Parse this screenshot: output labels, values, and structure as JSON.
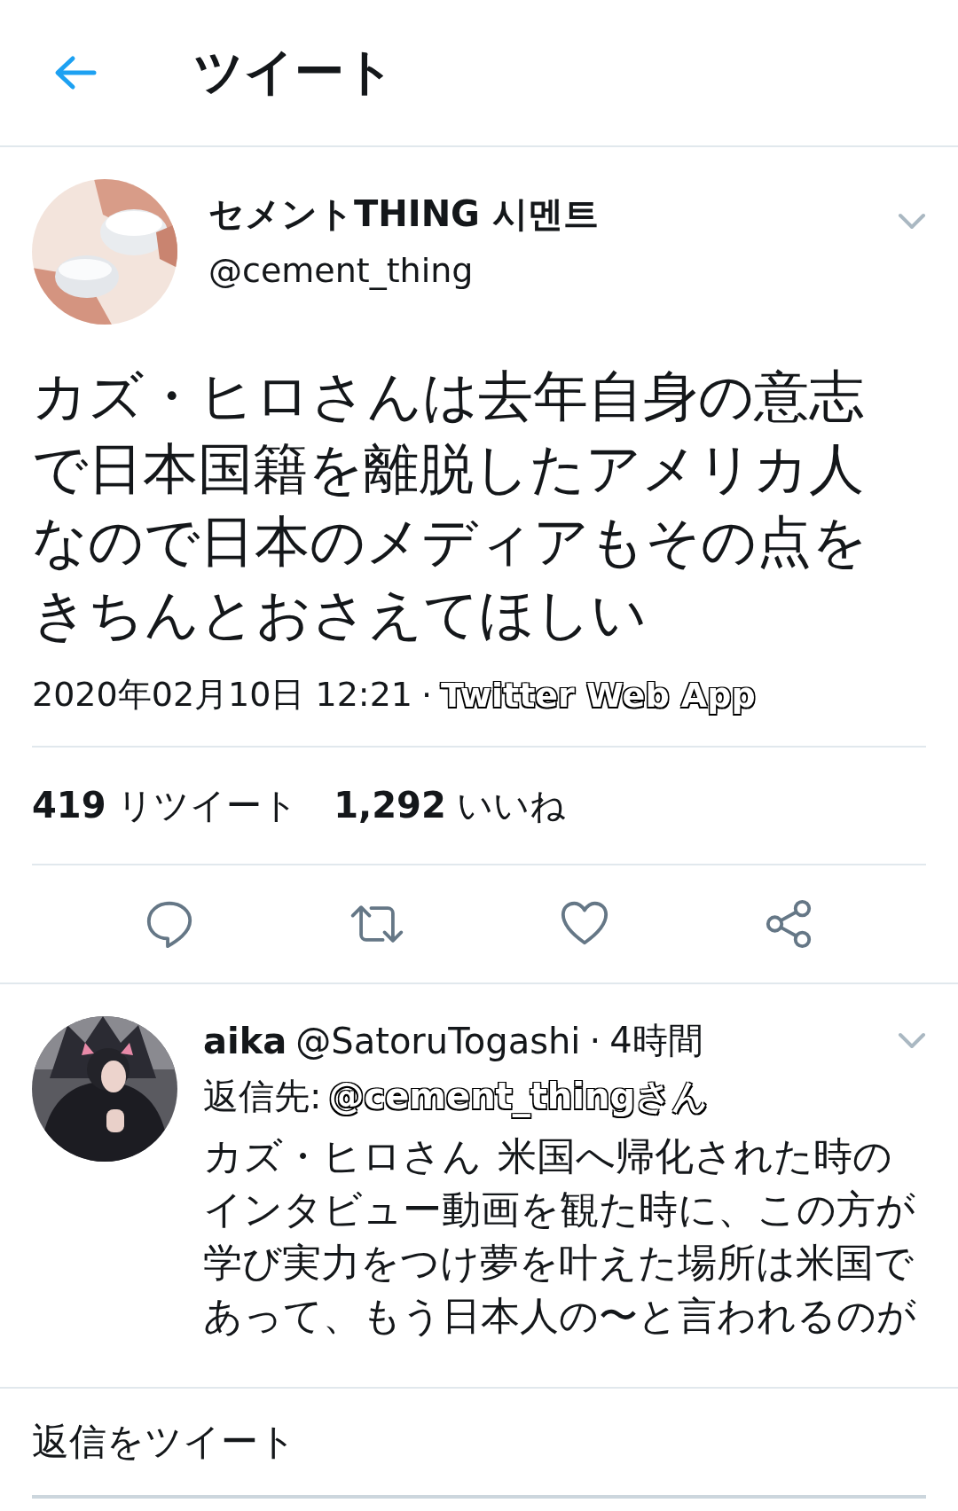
{
  "header": {
    "title": "ツイート"
  },
  "tweet": {
    "display_name": "セメントTHING 시멘트",
    "handle": "@cement_thing",
    "text": "カズ・ヒロさんは去年自身の意志で日本国籍を離脱したアメリカ人なので日本のメディアもその点をきちんとおさえてほしい",
    "timestamp": "2020年02月10日 12:21",
    "separator": "·",
    "source": "Twitter Web App",
    "stats": [
      {
        "count": "419",
        "label": "リツイート"
      },
      {
        "count": "1,292",
        "label": "いいね"
      }
    ]
  },
  "reply": {
    "display_name": "aika",
    "handle": "@SatoruTogashi",
    "separator": "·",
    "time": "4時間",
    "reply_to_label": "返信先:",
    "reply_to": "@cement_thingさん",
    "text": "カズ・ヒロさん 米国へ帰化された時のインタビュー動画を観た時に、この方が学び実力をつけ夢を叶えた場所は米国であって、もう日本人の〜と言われるのが"
  },
  "compose": {
    "placeholder": "返信をツイート"
  }
}
